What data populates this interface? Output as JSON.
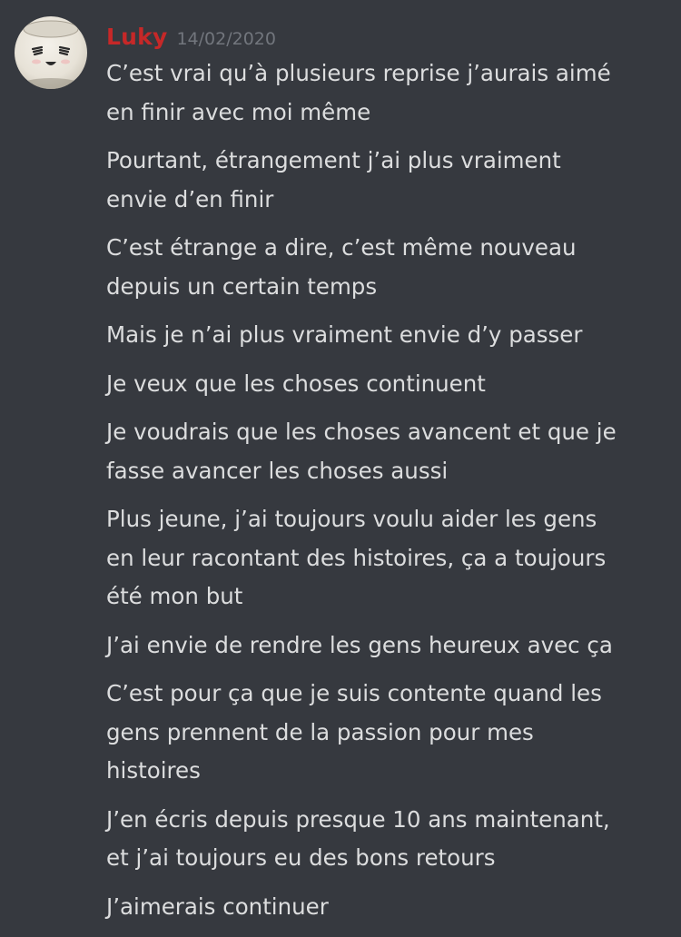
{
  "author": {
    "username": "Luky",
    "timestamp": "14/02/2020",
    "username_color": "#c62828",
    "avatar_icon": "smiling-cup-avatar"
  },
  "theme": {
    "background": "#36393f",
    "text_color": "#dcddde",
    "timestamp_color": "#72767d"
  },
  "messages": [
    {
      "text": "C’est vrai qu’à plusieurs reprise j’aurais aimé\nen finir avec moi même"
    },
    {
      "text": "Pourtant, étrangement j’ai plus vraiment\nenvie d’en finir"
    },
    {
      "text": "C’est étrange a dire, c’est même nouveau\ndepuis un certain temps"
    },
    {
      "text": "Mais je n’ai plus vraiment envie d’y passer"
    },
    {
      "text": "Je veux que les choses continuent"
    },
    {
      "text": "Je voudrais que les choses avancent et que je\nfasse avancer les choses aussi"
    },
    {
      "text": "Plus jeune, j’ai toujours voulu aider les gens\nen leur racontant des histoires, ça a toujours\nété mon but"
    },
    {
      "text": "J’ai envie de rendre les gens heureux avec ça"
    },
    {
      "text": "C’est pour ça que je suis contente quand les\ngens prennent de la passion pour mes\nhistoires"
    },
    {
      "text": "J’en écris depuis presque 10 ans maintenant,\net j’ai toujours eu des bons retours"
    },
    {
      "text": "J’aimerais continuer"
    }
  ]
}
